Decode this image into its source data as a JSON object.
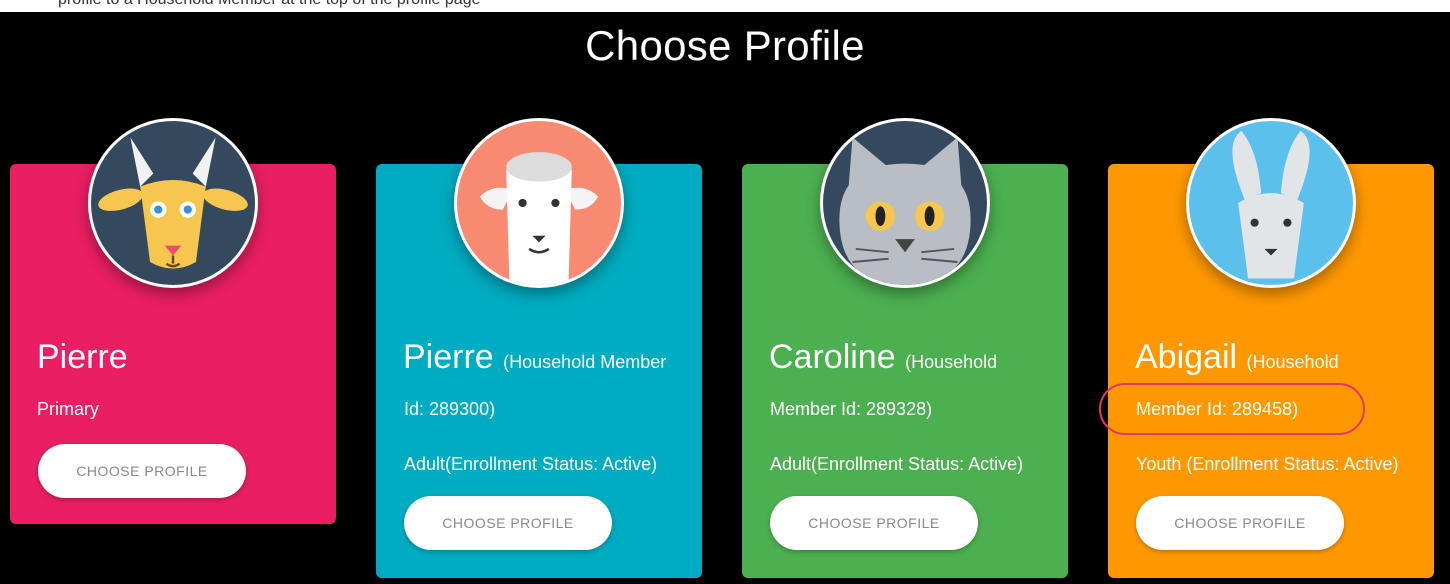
{
  "page": {
    "top_strip_text": "profile to a Household Member at the top of the profile page",
    "title": "Choose Profile"
  },
  "colors": {
    "pink": "#e91e63",
    "teal": "#00acc1",
    "green": "#4caf50",
    "orange": "#ff9800",
    "highlight": "#e3395f"
  },
  "profiles": [
    {
      "name": "Pierre",
      "detail": "",
      "line1": "Primary",
      "line2": "",
      "button": "CHOOSE PROFILE",
      "avatar": "goat-icon"
    },
    {
      "name": "Pierre",
      "detail": "(Household Member",
      "line1": "Id: 289300)",
      "line2": "Adult(Enrollment Status: Active)",
      "button": "CHOOSE PROFILE",
      "avatar": "sheep-icon"
    },
    {
      "name": "Caroline",
      "detail": "(Household",
      "line1": "Member Id: 289328)",
      "line2": "Adult(Enrollment Status: Active)",
      "button": "CHOOSE PROFILE",
      "avatar": "cat-icon"
    },
    {
      "name": "Abigail",
      "detail": "(Household",
      "line1": "Member Id: 289458)",
      "line2": "Youth (Enrollment Status: Active)",
      "button": "CHOOSE PROFILE",
      "avatar": "rabbit-icon"
    }
  ]
}
